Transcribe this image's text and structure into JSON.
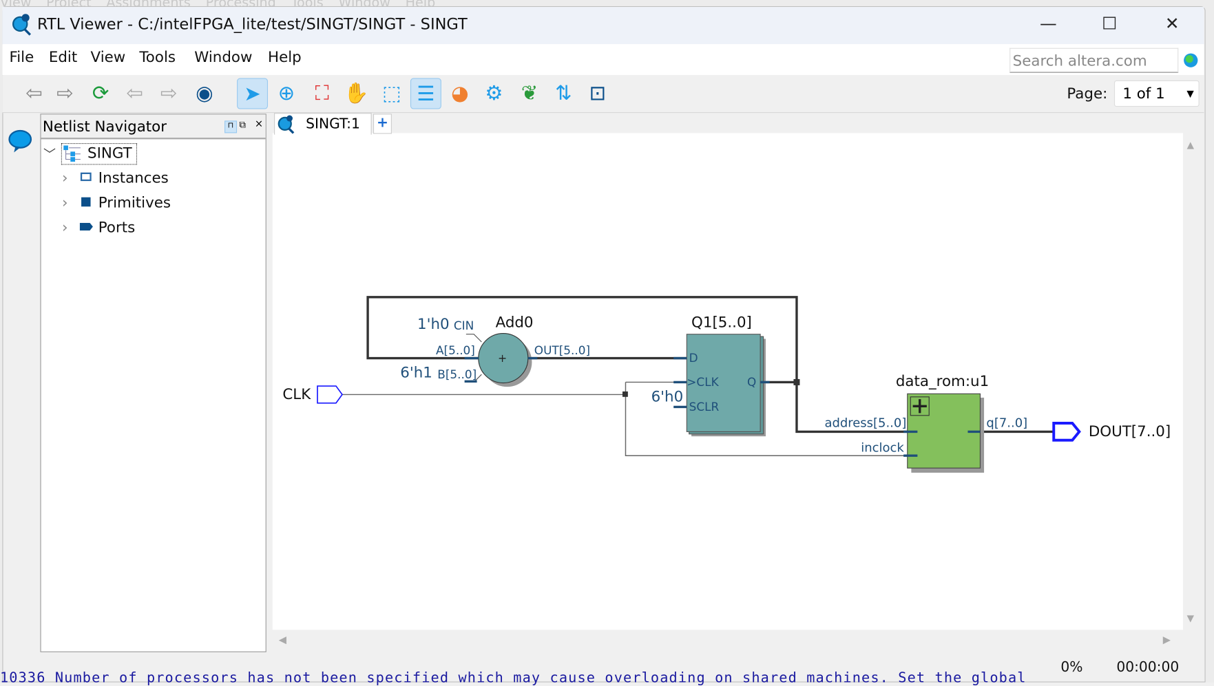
{
  "background_menu": "View Project Assignments Processing Tools Window Help",
  "window": {
    "title": "RTL Viewer - C:/intelFPGA_lite/test/SINGT/SINGT - SINGT",
    "minimize": "—",
    "maximize": "☐",
    "close": "✕"
  },
  "menu": [
    "File",
    "Edit",
    "View",
    "Tools",
    "Window",
    "Help"
  ],
  "search": {
    "placeholder": "Search altera.com"
  },
  "toolbar": {
    "icons": [
      "back-icon",
      "forward-icon",
      "refresh-icon",
      "previous-icon",
      "next-icon",
      "binoculars-icon",
      "select-icon",
      "zoom-icon",
      "fit-icon",
      "hand-icon",
      "area-select-icon",
      "hierarchy-icon",
      "palette-icon",
      "settings-icon",
      "bird-icon",
      "netlist-icon",
      "schematic-icon"
    ],
    "page_label": "Page:",
    "page_value": "1 of 1"
  },
  "navigator": {
    "title": "Netlist Navigator",
    "root": "SINGT",
    "items": [
      "Instances",
      "Primitives",
      "Ports"
    ]
  },
  "tabs": [
    {
      "label": "SINGT:1"
    }
  ],
  "add_tab": "+",
  "schematic": {
    "adder": {
      "name": "Add0",
      "cin_const": "1'h0",
      "cin": "CIN",
      "a": "A[5..0]",
      "b": "B[5..0]",
      "b_const": "6'h1",
      "out": "OUT[5..0]",
      "op": "+"
    },
    "register": {
      "name": "Q1[5..0]",
      "d": "D",
      "clk": ">CLK",
      "sclr": "SCLR",
      "q": "Q",
      "sclr_const": "6'h0"
    },
    "rom": {
      "name": "data_rom:u1",
      "address": "address[5..0]",
      "inclock": "inclock",
      "q": "q[7..0]"
    },
    "input_port": "CLK",
    "output_port": "DOUT[7..0]",
    "colors": {
      "adder": "#6fa9a9",
      "register": "#6fa9a9",
      "rom": "#84c05c",
      "port": "#1a1aff",
      "pin": "#1f4f7a"
    }
  },
  "status": {
    "progress": "0%",
    "time": "00:00:00"
  },
  "message": "10336 Number of processors has not been specified which may cause overloading on shared machines.  Set the global"
}
